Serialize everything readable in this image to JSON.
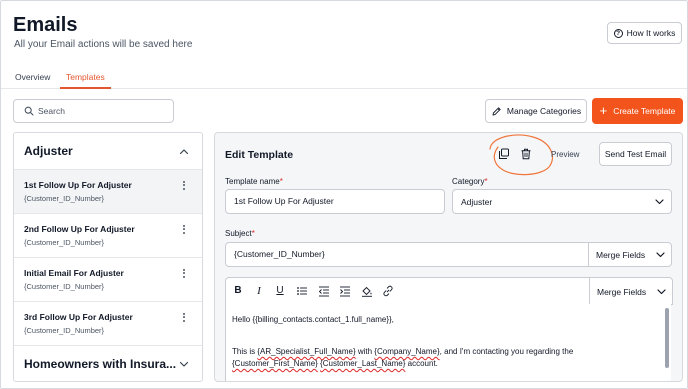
{
  "header": {
    "title": "Emails",
    "subtitle": "All your Email actions will be saved here",
    "how_it_works": "How It works"
  },
  "tabs": [
    {
      "label": "Overview",
      "active": false
    },
    {
      "label": "Templates",
      "active": true
    }
  ],
  "search": {
    "placeholder": "Search",
    "value": ""
  },
  "actions": {
    "manage_categories": "Manage Categories",
    "create_template": "Create Template"
  },
  "colors": {
    "accent": "#f2541b",
    "tab_active": "#e4572e",
    "annotation": "#f0763c"
  },
  "categories": [
    {
      "name": "Adjuster",
      "expanded": true,
      "templates": [
        {
          "title": "1st Follow Up For Adjuster",
          "subtitle": "{Customer_ID_Number}",
          "selected": true
        },
        {
          "title": "2nd Follow Up For Adjuster",
          "subtitle": "{Customer_ID_Number}",
          "selected": false
        },
        {
          "title": "Initial Email For Adjuster",
          "subtitle": "{Customer_ID_Number}",
          "selected": false
        },
        {
          "title": "3rd Follow Up For Adjuster",
          "subtitle": "{Customer_ID_Number}",
          "selected": false
        }
      ]
    },
    {
      "name": "Homeowners with Insura...",
      "expanded": false
    }
  ],
  "editor": {
    "heading": "Edit Template",
    "preview": "Preview",
    "send_test": "Send Test Email",
    "template_name_label": "Template name",
    "template_name_value": "1st Follow Up For Adjuster",
    "category_label": "Category",
    "category_value": "Adjuster",
    "subject_label": "Subject",
    "subject_value": "{Customer_ID_Number}",
    "merge_fields": "Merge Fields",
    "body_line1": "Hello {{billing_contacts.contact_1.full_name}},",
    "body_line2_a": "This is ",
    "body_line2_b": "{AR_Specialist_Full_Name}",
    "body_line2_c": " with ",
    "body_line2_d": "{Company_Name}",
    "body_line2_e": ", and I'm contacting you regarding the",
    "body_line3_a": "{Customer_First_Name}",
    "body_line3_b": " ",
    "body_line3_c": "{Customer_Last_Name}",
    "body_line3_d": " account."
  },
  "icons": {
    "how_it_works": "question-circle-icon",
    "search": "search-icon",
    "manage": "pencil-icon",
    "create": "plus-icon",
    "copy": "copy-icon",
    "delete": "trash-icon",
    "toolbar": [
      "bold-icon",
      "italic-icon",
      "underline-icon",
      "bullet-list-icon",
      "outdent-icon",
      "indent-icon",
      "fill-color-icon",
      "link-icon"
    ]
  }
}
